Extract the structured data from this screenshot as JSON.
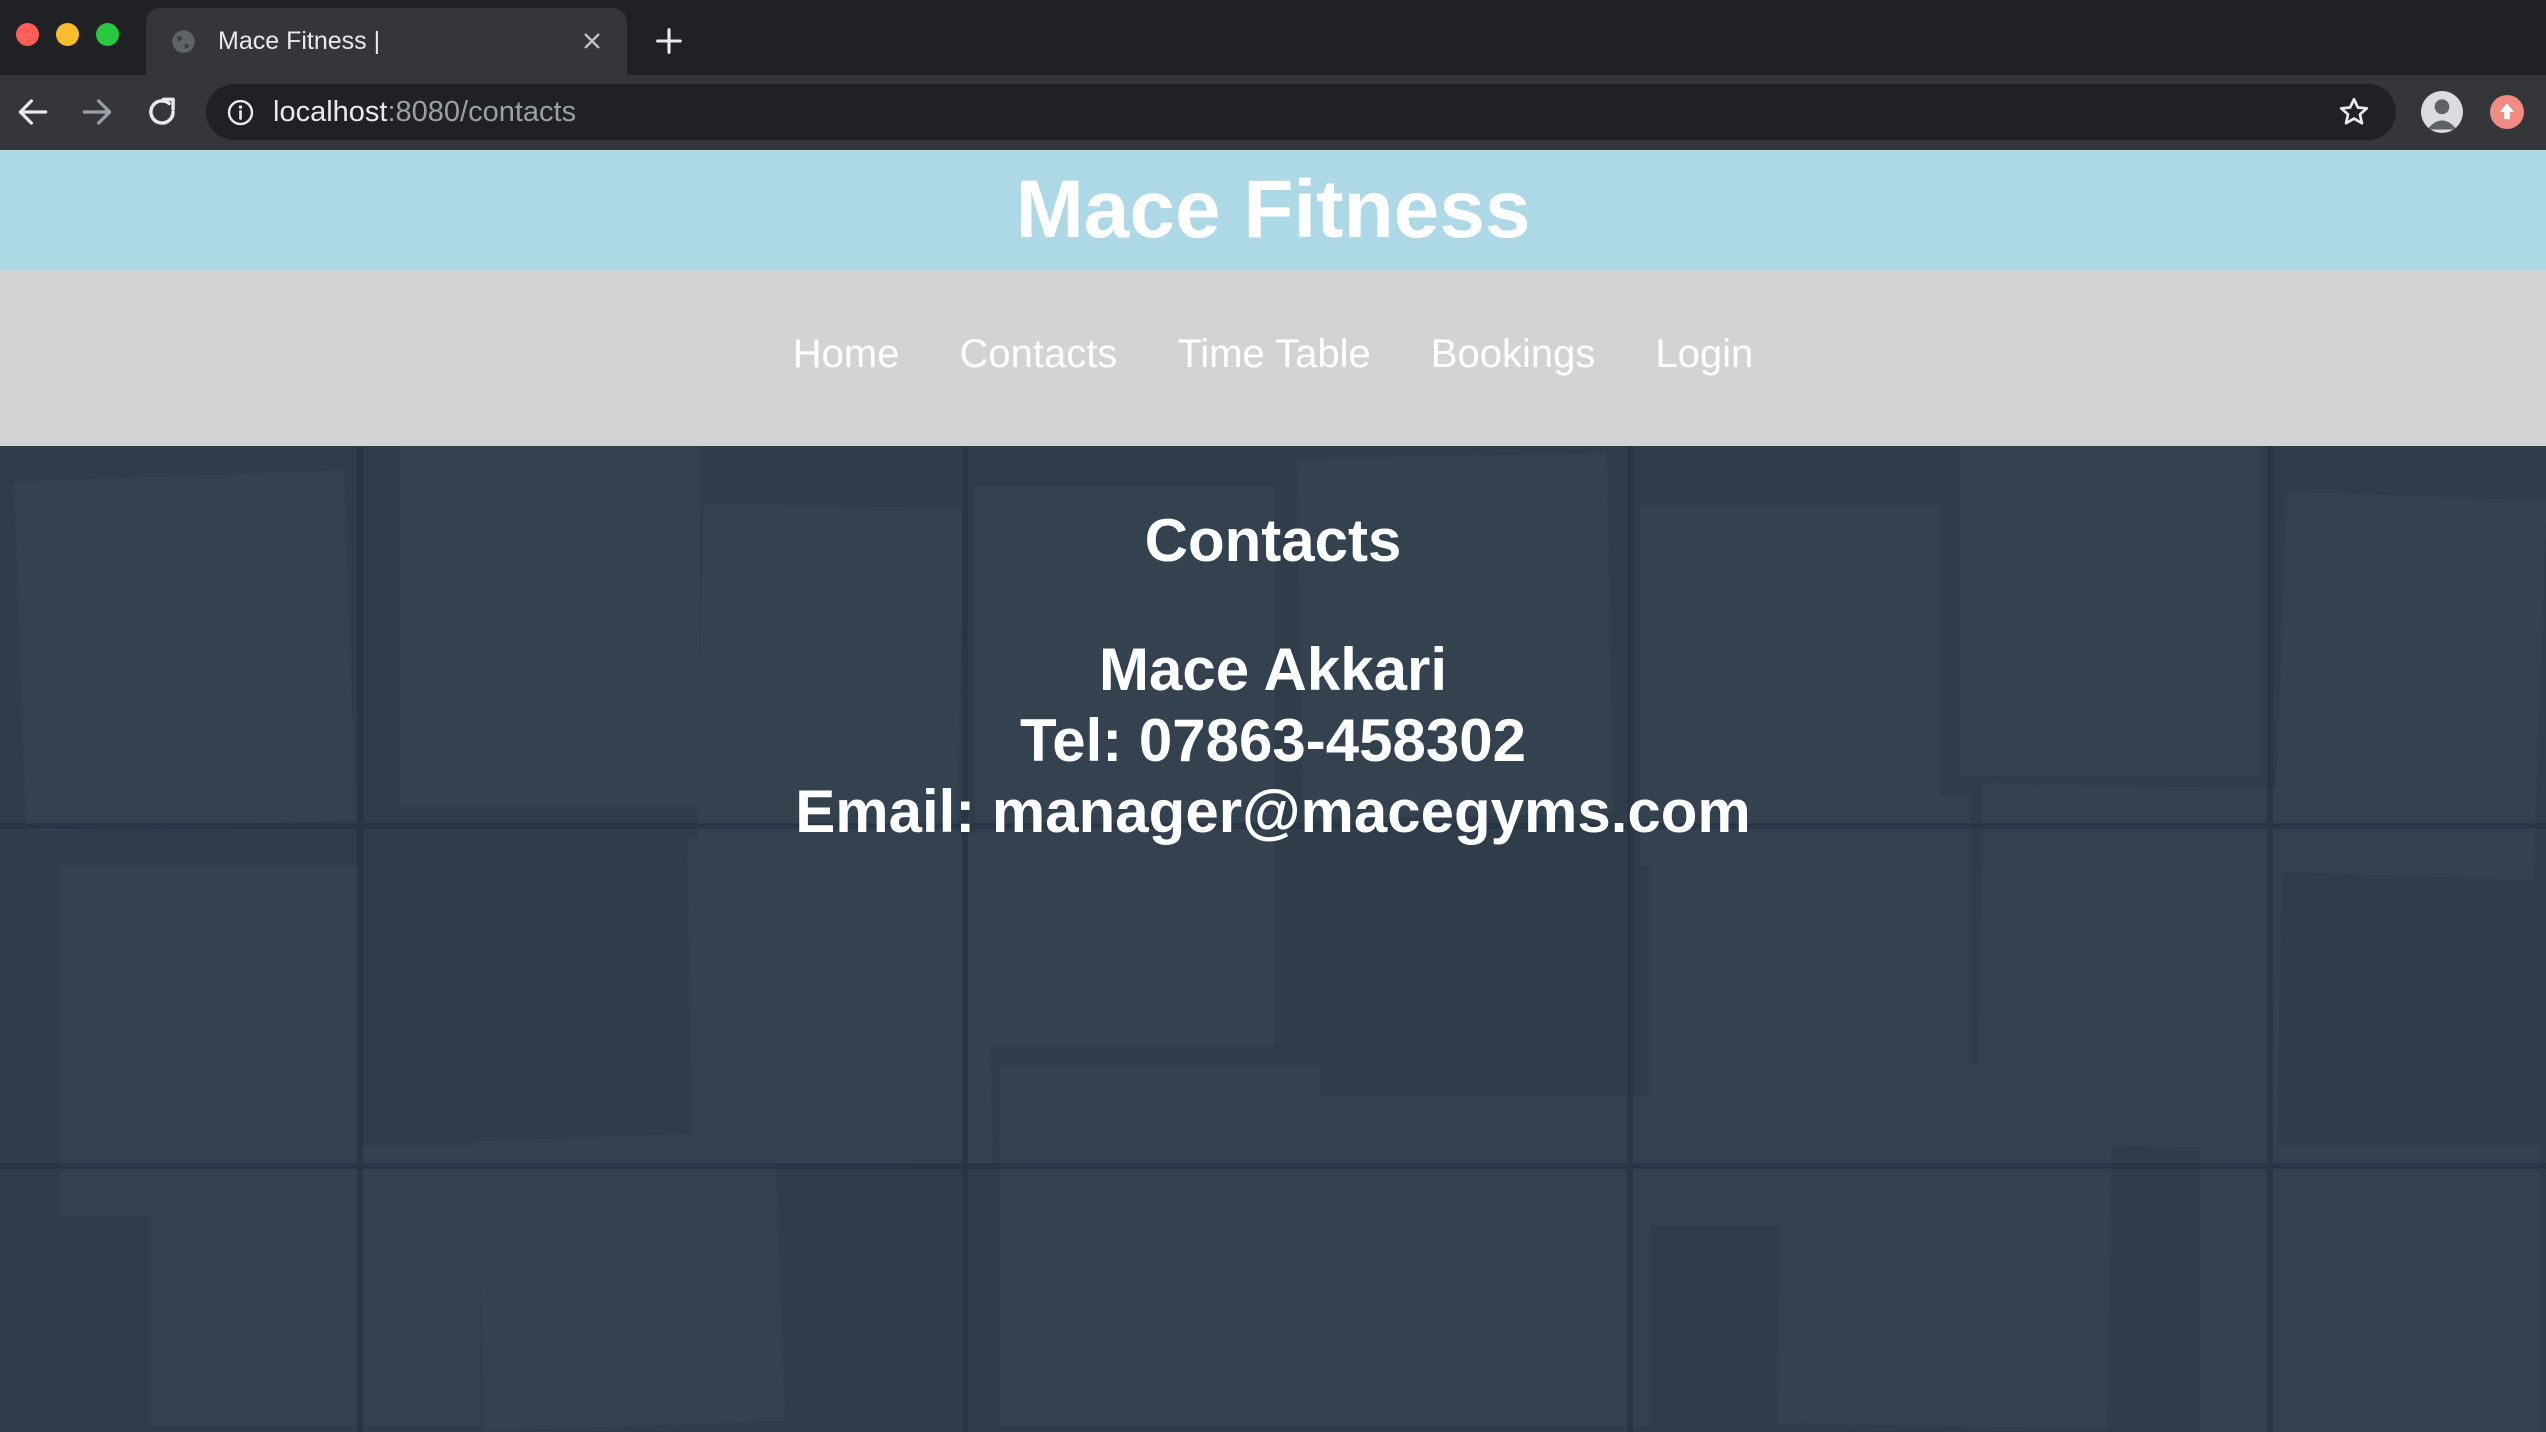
{
  "browser": {
    "tab_title": "Mace Fitness |",
    "url_host": "localhost",
    "url_path": ":8080/contacts"
  },
  "site": {
    "title": "Mace Fitness",
    "nav": [
      {
        "label": "Home"
      },
      {
        "label": "Contacts"
      },
      {
        "label": "Time Table"
      },
      {
        "label": "Bookings"
      },
      {
        "label": "Login"
      }
    ]
  },
  "contacts": {
    "heading": "Contacts",
    "name": "Mace Akkari",
    "tel": "Tel: 07863-458302",
    "email": "Email: manager@macegyms.com"
  },
  "colors": {
    "header_bg": "#add8e6",
    "nav_bg": "#d3d3d3",
    "content_bg": "#2f3c4a"
  }
}
